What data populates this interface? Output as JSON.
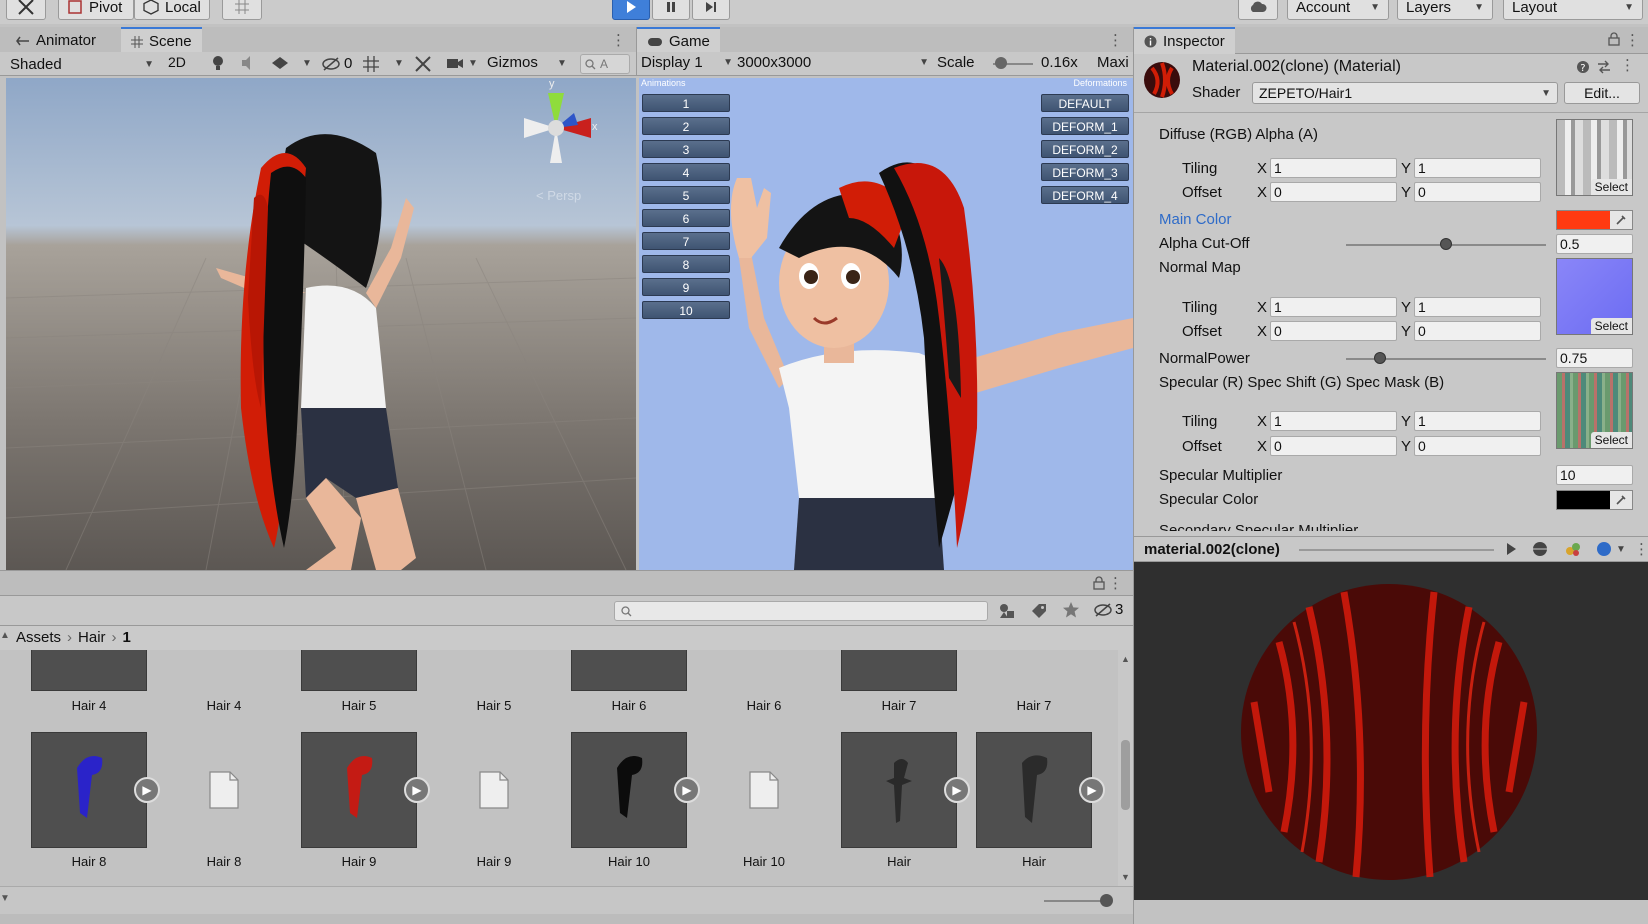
{
  "toolbar": {
    "pivot": "Pivot",
    "local": "Local",
    "account": "Account",
    "layers": "Layers",
    "layout": "Layout"
  },
  "scene_panel": {
    "tabs": [
      "Animator",
      "Scene"
    ],
    "shading": "Shaded",
    "mode_2d": "2D",
    "hidden_count": "0",
    "gizmos": "Gizmos",
    "search_placeholder": "A",
    "gizmo_axes": {
      "y": "y",
      "x": "x"
    },
    "persp": "Persp"
  },
  "game_panel": {
    "tab": "Game",
    "display": "Display 1",
    "resolution": "3000x3000",
    "scale_label": "Scale",
    "scale_value": "0.16x",
    "maximize": "Maxi",
    "animations_label": "Animations",
    "animations": [
      "1",
      "2",
      "3",
      "4",
      "5",
      "6",
      "7",
      "8",
      "9",
      "10"
    ],
    "deformations_label": "Deformations",
    "deformations": [
      "DEFAULT",
      "DEFORM_1",
      "DEFORM_2",
      "DEFORM_3",
      "DEFORM_4"
    ]
  },
  "inspector": {
    "tab": "Inspector",
    "title": "Material.002(clone) (Material)",
    "shader_label": "Shader",
    "shader_value": "ZEPETO/Hair1",
    "edit_button": "Edit...",
    "diffuse_label": "Diffuse (RGB) Alpha (A)",
    "tiling_label": "Tiling",
    "offset_label": "Offset",
    "x_label": "X",
    "y_label": "Y",
    "diffuse_tiling": [
      "1",
      "1"
    ],
    "diffuse_offset": [
      "0",
      "0"
    ],
    "select_label": "Select",
    "main_color_label": "Main Color",
    "main_color": "#ff3a10",
    "alpha_cutoff_label": "Alpha Cut-Off",
    "alpha_cutoff": "0.5",
    "normal_map_label": "Normal Map",
    "normal_tiling": [
      "1",
      "1"
    ],
    "normal_offset": [
      "0",
      "0"
    ],
    "normal_power_label": "NormalPower",
    "normal_power": "0.75",
    "specular_map_label": "Specular (R) Spec Shift (G) Spec Mask (B)",
    "spec_tiling": [
      "1",
      "1"
    ],
    "spec_offset": [
      "0",
      "0"
    ],
    "spec_multiplier_label": "Specular Multiplier",
    "spec_multiplier": "10",
    "spec_color_label": "Specular Color",
    "spec_color": "#000000",
    "secondary_label": "Secondary Specular Multiplier"
  },
  "preview": {
    "name": "material.002(clone)"
  },
  "project": {
    "search_placeholder": "",
    "hidden_count": "3",
    "breadcrumb": [
      "Assets",
      "Hair",
      "1"
    ],
    "row1": [
      "Hair 4",
      "Hair 4",
      "Hair 5",
      "Hair 5",
      "Hair 6",
      "Hair 6",
      "Hair 7",
      "Hair 7"
    ],
    "row2": [
      "Hair 8",
      "Hair 8",
      "Hair 9",
      "Hair 9",
      "Hair 10",
      "Hair 10",
      "Hair",
      "Hair"
    ]
  }
}
